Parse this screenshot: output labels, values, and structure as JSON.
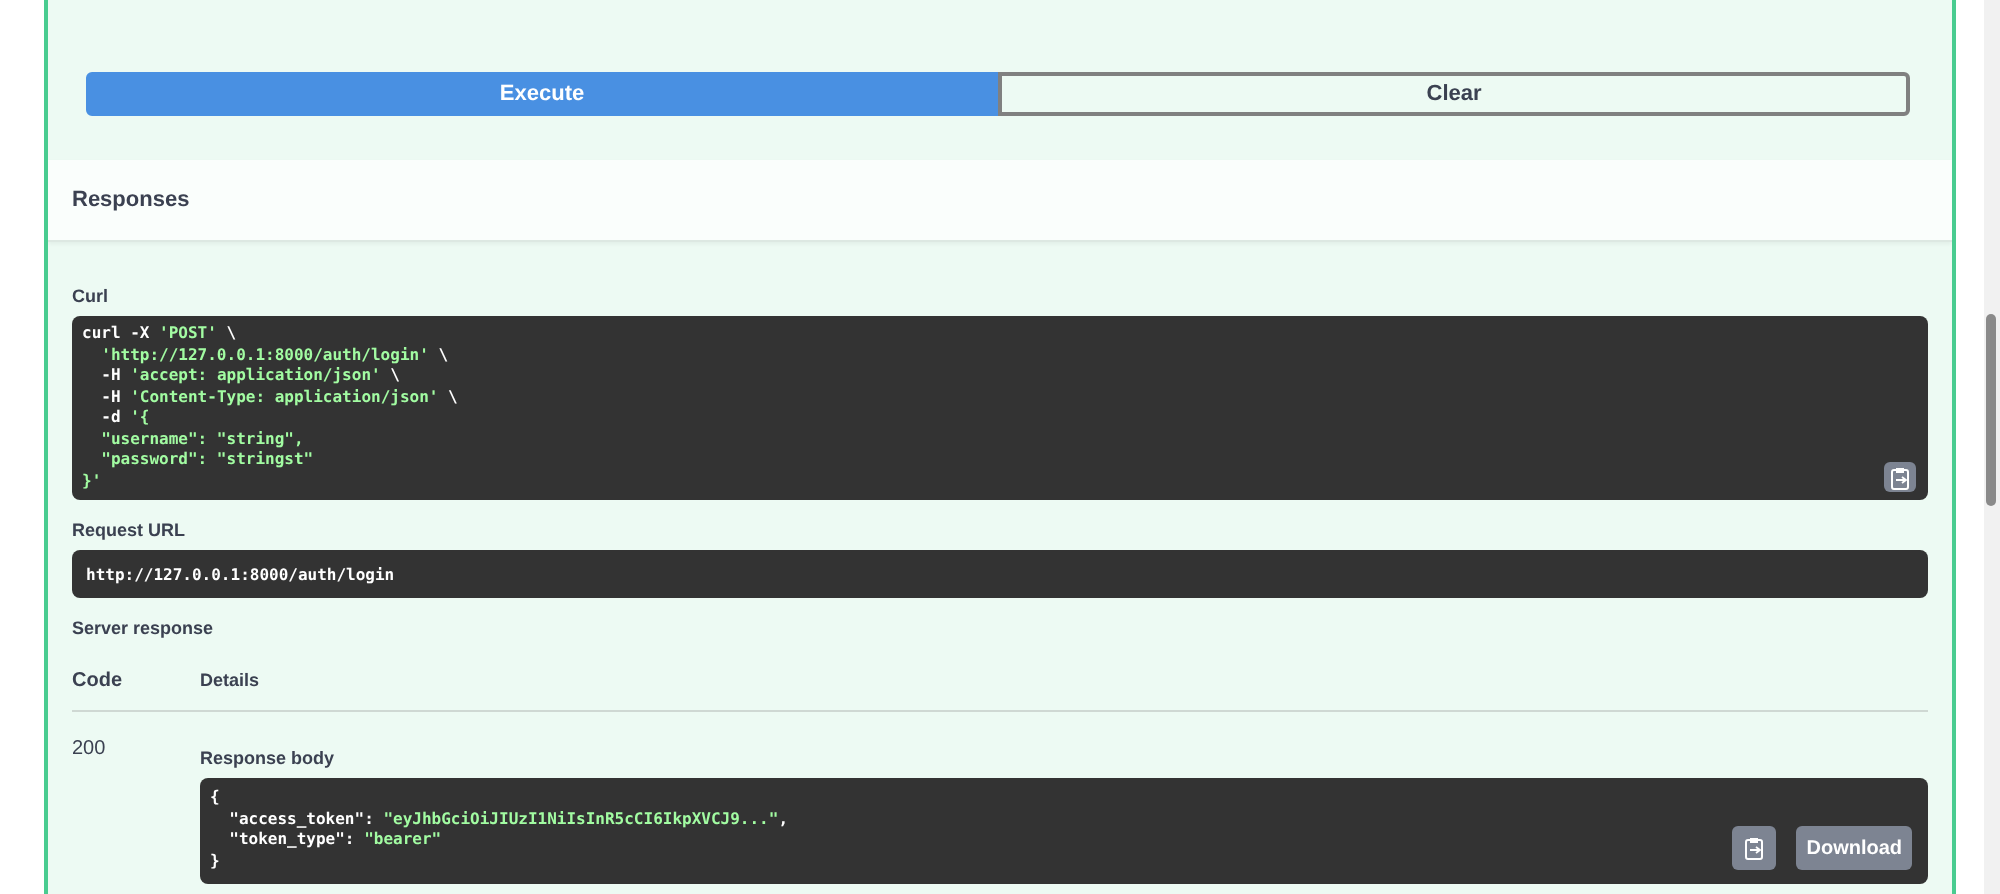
{
  "actions": [
    {
      "label": "Execute",
      "kind": "primary"
    },
    {
      "label": "Clear",
      "kind": "secondary"
    }
  ],
  "responses_title": "Responses",
  "curl": {
    "label": "Curl",
    "lines": [
      [
        {
          "t": "curl -X ",
          "kind": "plain"
        },
        {
          "t": "'POST'",
          "kind": "string"
        },
        {
          "t": " \\",
          "kind": "plain"
        }
      ],
      [
        {
          "t": "  'http://127.0.0.1:8000/auth/login'",
          "kind": "string"
        },
        {
          "t": " \\",
          "kind": "plain"
        }
      ],
      [
        {
          "t": "  -H ",
          "kind": "plain"
        },
        {
          "t": "'accept: application/json'",
          "kind": "string"
        },
        {
          "t": " \\",
          "kind": "plain"
        }
      ],
      [
        {
          "t": "  -H ",
          "kind": "plain"
        },
        {
          "t": "'Content-Type: application/json'",
          "kind": "string"
        },
        {
          "t": " \\",
          "kind": "plain"
        }
      ],
      [
        {
          "t": "  -d ",
          "kind": "plain"
        },
        {
          "t": "'{",
          "kind": "string"
        }
      ],
      [
        {
          "t": "  \"username\": \"string\",",
          "kind": "string"
        }
      ],
      [
        {
          "t": "  \"password\": \"stringst\"",
          "kind": "string"
        }
      ],
      [
        {
          "t": "}'",
          "kind": "string"
        }
      ]
    ]
  },
  "request_url": {
    "label": "Request URL",
    "value": "http://127.0.0.1:8000/auth/login"
  },
  "server_response": {
    "label": "Server response",
    "columns": [
      "Code",
      "Details"
    ],
    "code": "200",
    "body_label": "Response body",
    "body_lines": [
      [
        {
          "t": "{",
          "kind": "plain"
        }
      ],
      [
        {
          "t": "  \"access_token\": ",
          "kind": "plain"
        },
        {
          "t": "\"eyJhbGciOiJIUzI1NiIsInR5cCI6IkpXVCJ9...\"",
          "kind": "string"
        },
        {
          "t": ",",
          "kind": "plain"
        }
      ],
      [
        {
          "t": "  \"token_type\": ",
          "kind": "plain"
        },
        {
          "t": "\"bearer\"",
          "kind": "string"
        }
      ],
      [
        {
          "t": "}",
          "kind": "plain"
        }
      ]
    ],
    "download": "Download"
  }
}
